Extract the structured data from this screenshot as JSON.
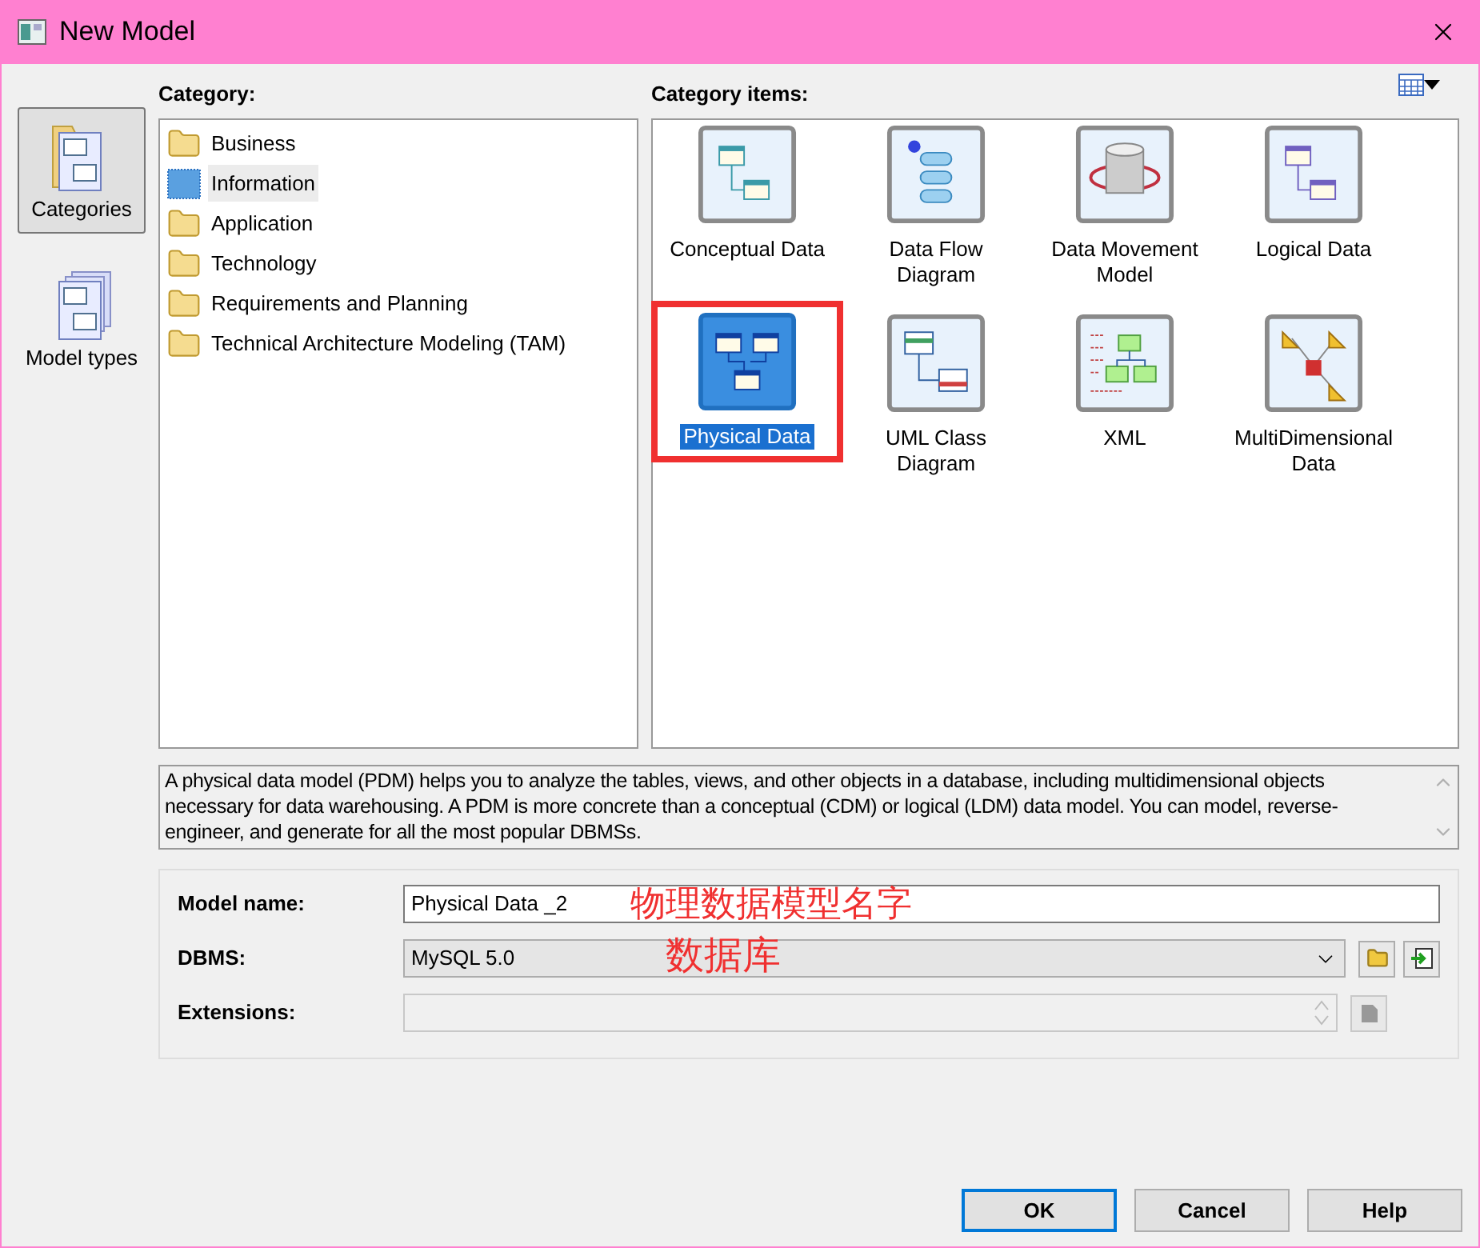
{
  "window": {
    "title": "New Model"
  },
  "nav": [
    {
      "label": "Categories",
      "selected": true
    },
    {
      "label": "Model types",
      "selected": false
    }
  ],
  "category": {
    "label": "Category:",
    "items": [
      {
        "label": "Business",
        "selected": false
      },
      {
        "label": "Information",
        "selected": true
      },
      {
        "label": "Application",
        "selected": false
      },
      {
        "label": "Technology",
        "selected": false
      },
      {
        "label": "Requirements and Planning",
        "selected": false
      },
      {
        "label": "Technical Architecture Modeling (TAM)",
        "selected": false
      }
    ]
  },
  "category_items": {
    "label": "Category items:",
    "items": [
      {
        "label": "Conceptual Data",
        "selected": false,
        "highlighted": false
      },
      {
        "label": "Data Flow Diagram",
        "selected": false,
        "highlighted": false
      },
      {
        "label": "Data Movement Model",
        "selected": false,
        "highlighted": false
      },
      {
        "label": "Logical Data",
        "selected": false,
        "highlighted": false
      },
      {
        "label": "Physical Data",
        "selected": true,
        "highlighted": true
      },
      {
        "label": "UML Class Diagram",
        "selected": false,
        "highlighted": false
      },
      {
        "label": "XML",
        "selected": false,
        "highlighted": false
      },
      {
        "label": "MultiDimensional Data",
        "selected": false,
        "highlighted": false
      }
    ]
  },
  "description": "A physical data model (PDM) helps you to analyze the tables, views, and other objects in a database, including multidimensional objects necessary for data warehousing. A PDM is more concrete than a conceptual (CDM) or logical (LDM) data model. You can model, reverse-engineer, and generate for all the most popular DBMSs.",
  "form": {
    "model_name": {
      "label": "Model name:",
      "value": "Physical Data _2"
    },
    "dbms": {
      "label": "DBMS:",
      "value": "MySQL 5.0"
    },
    "extensions": {
      "label": "Extensions:",
      "disabled": true
    }
  },
  "annotations": [
    {
      "text": "物理数据模型名字"
    },
    {
      "text": "数据库"
    }
  ],
  "buttons": [
    {
      "label": "OK",
      "default": true
    },
    {
      "label": "Cancel",
      "default": false
    },
    {
      "label": "Help",
      "default": false
    }
  ]
}
